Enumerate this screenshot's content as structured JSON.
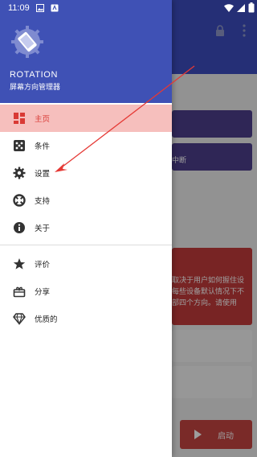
{
  "statusbar": {
    "time": "11:09"
  },
  "drawer": {
    "app_name": "ROTATION",
    "app_subtitle": "屏幕方向管理器",
    "items": [
      {
        "label": "主页",
        "icon": "dashboard-icon",
        "active": true
      },
      {
        "label": "条件",
        "icon": "conditions-icon",
        "active": false
      },
      {
        "label": "设置",
        "icon": "gear-icon",
        "active": false
      },
      {
        "label": "支持",
        "icon": "lifebuoy-icon",
        "active": false
      },
      {
        "label": "关于",
        "icon": "info-icon",
        "active": false
      }
    ],
    "items2": [
      {
        "label": "评价",
        "icon": "star-icon"
      },
      {
        "label": "分享",
        "icon": "share-icon"
      },
      {
        "label": "优质的",
        "icon": "diamond-icon"
      }
    ]
  },
  "background": {
    "card_b_text": "中断",
    "card_red_lines": [
      "取决于用户如何握住设",
      "每些设备默认情况下不",
      "部四个方向。请使用"
    ],
    "start_label": "启动"
  },
  "colors": {
    "primary": "#3f51b5",
    "active_bg": "#f6bfbd",
    "active_fg": "#d93a35",
    "accent_red": "#c64442",
    "arrow": "#e53935"
  }
}
